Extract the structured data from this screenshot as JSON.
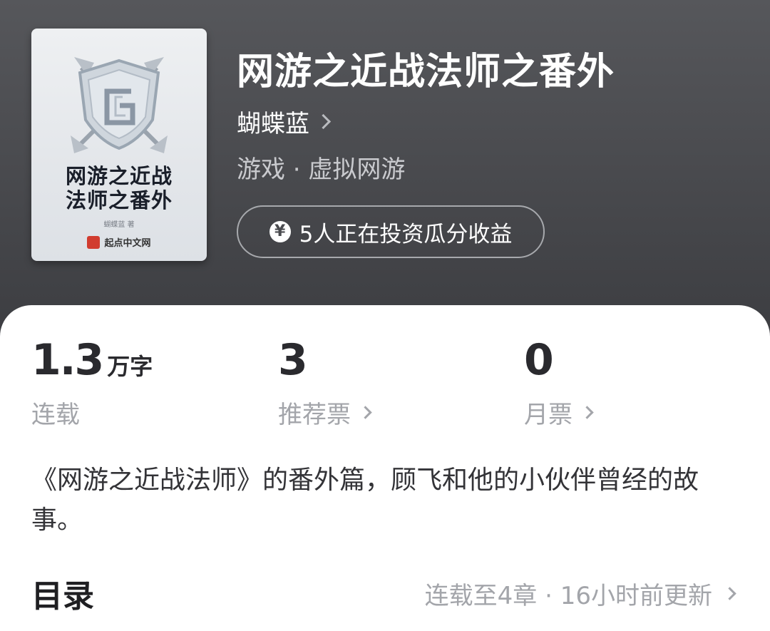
{
  "book": {
    "title": "网游之近战法师之番外",
    "author": "蝴蝶蓝",
    "genre": "游戏 · 虚拟网游",
    "invest_text": "5人正在投资瓜分收益"
  },
  "cover": {
    "title_line1": "网游之近战",
    "title_line2": "法师之番外",
    "author_text": "蝴蝶蓝 著",
    "publisher": "起点中文网"
  },
  "stats": {
    "words": {
      "value": "1.3",
      "unit": "万字",
      "label": "连载"
    },
    "recommend": {
      "value": "3",
      "label": "推荐票"
    },
    "monthly": {
      "value": "0",
      "label": "月票"
    }
  },
  "description": "《网游之近战法师》的番外篇，顾飞和他的小伙伴曾经的故事。",
  "toc": {
    "title": "目录",
    "status": "连载至4章 · 16小时前更新"
  },
  "colors": {
    "header_bg": "#4a4b4f",
    "card_bg": "#ffffff",
    "muted_text": "#a3a5aa"
  }
}
